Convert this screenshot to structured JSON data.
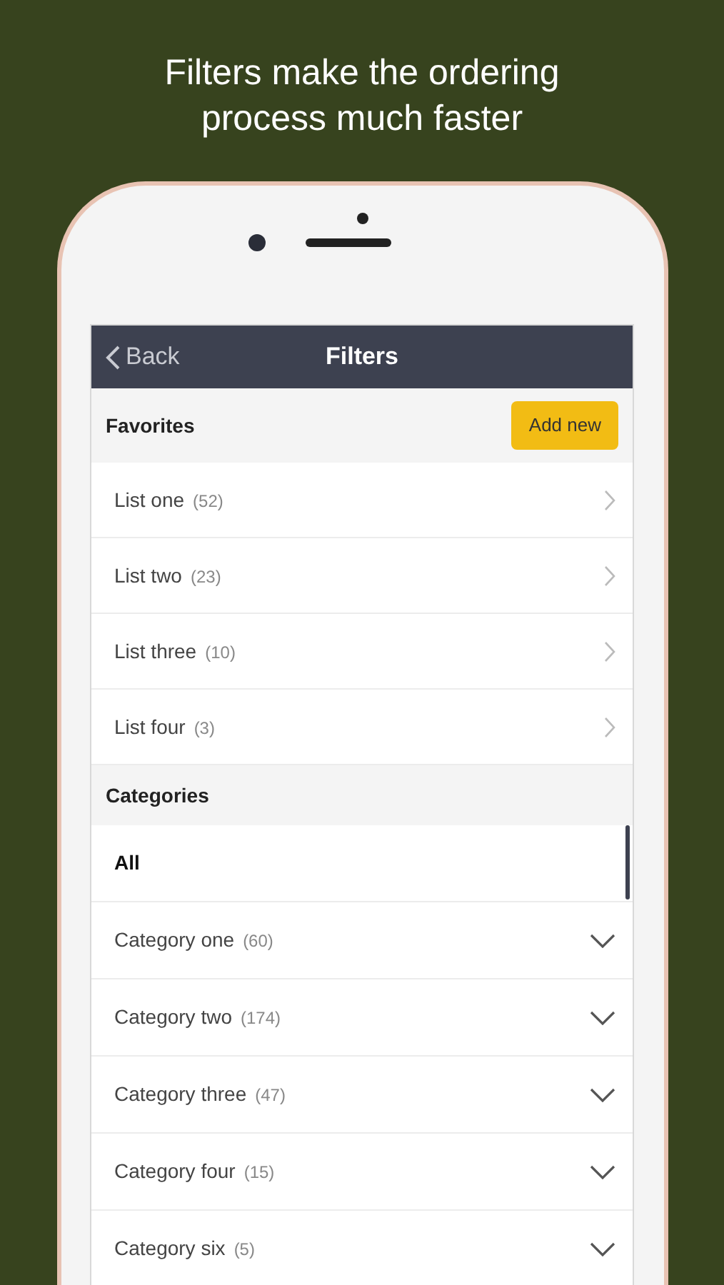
{
  "headline": "Filters make the ordering process much faster",
  "nav": {
    "back": "Back",
    "title": "Filters"
  },
  "favorites": {
    "title": "Favorites",
    "add_button": "Add new",
    "items": [
      {
        "name": "List one",
        "count": "(52)"
      },
      {
        "name": "List two",
        "count": "(23)"
      },
      {
        "name": "List three",
        "count": "(10)"
      },
      {
        "name": "List four",
        "count": "(3)"
      }
    ]
  },
  "categories": {
    "title": "Categories",
    "items": [
      {
        "name": "All",
        "selected": true
      },
      {
        "name": "Category one",
        "count": "(60)",
        "selected": false
      },
      {
        "name": "Category two",
        "count": "(174)",
        "selected": false
      },
      {
        "name": "Category three",
        "count": "(47)",
        "selected": false
      },
      {
        "name": "Category four",
        "count": "(15)",
        "selected": false
      },
      {
        "name": "Category six",
        "count": "(5)",
        "selected": false
      }
    ]
  }
}
